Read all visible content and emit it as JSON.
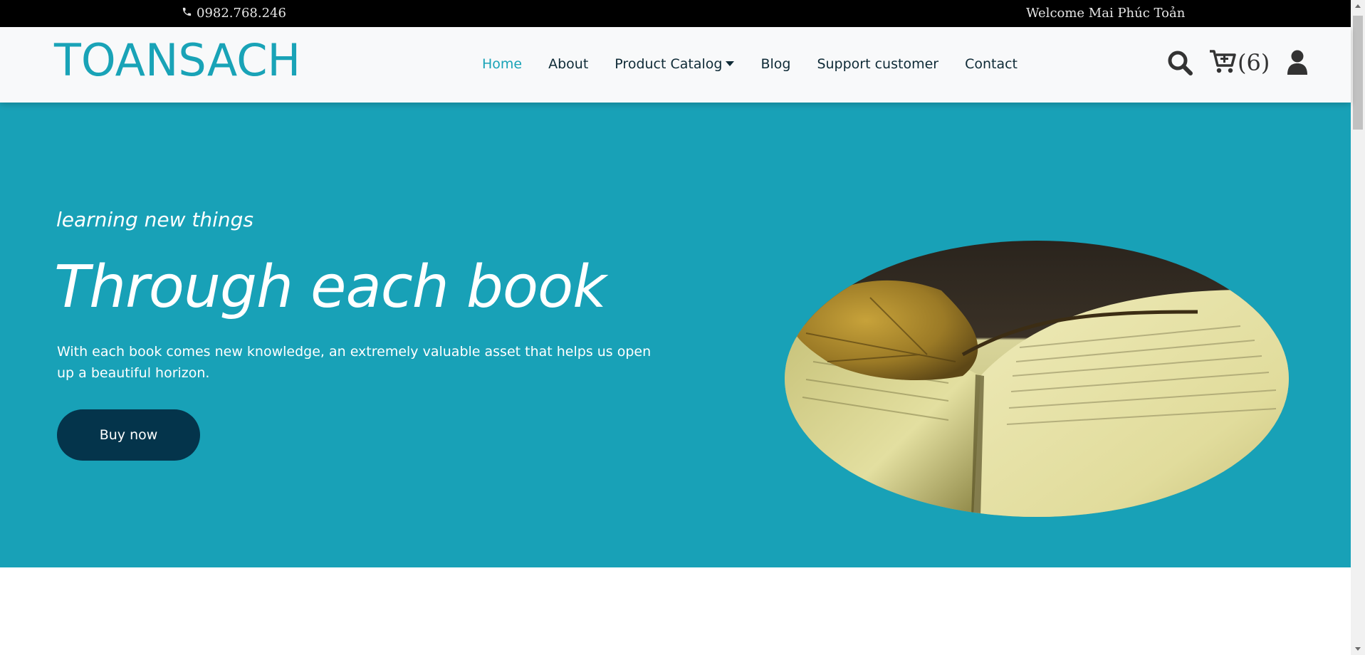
{
  "topbar": {
    "phone": "0982.768.246",
    "phone_icon": "phone-icon",
    "welcome": "Welcome Mai Phúc Toản"
  },
  "header": {
    "logo": "TOANSACH",
    "nav": [
      {
        "label": "Home",
        "active": true
      },
      {
        "label": "About",
        "active": false
      },
      {
        "label": "Product Catalog",
        "active": false,
        "dropdown": true
      },
      {
        "label": "Blog",
        "active": false
      },
      {
        "label": "Support customer",
        "active": false
      },
      {
        "label": "Contact",
        "active": false
      }
    ],
    "cart_count": "(6)",
    "icons": [
      "search-icon",
      "cart-plus-icon",
      "user-icon"
    ]
  },
  "hero": {
    "subtitle": "learning new things",
    "title": "Through each book",
    "description": "With each book comes new knowledge, an extremely valuable asset that helps us open up a beautiful horizon.",
    "button": "Buy now",
    "image": "open-book-with-autumn-leaf"
  },
  "colors": {
    "brand": "#19a3b7",
    "hero_bg": "#18a1b7",
    "button_bg": "#04344b",
    "nav_text": "#0e2a36",
    "topbar_bg": "#000000"
  }
}
